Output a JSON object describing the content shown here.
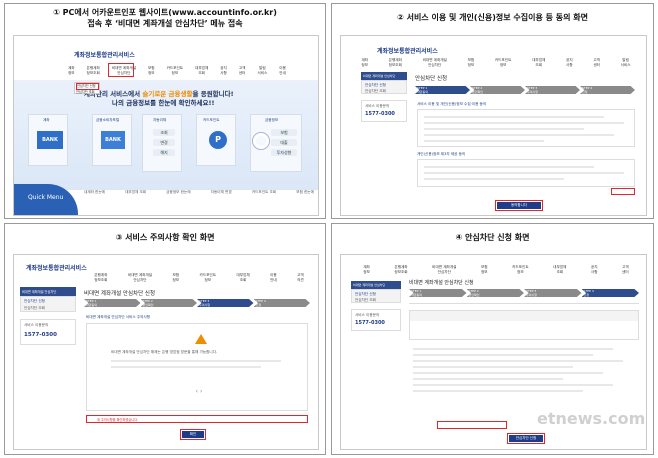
{
  "captions": {
    "p1_line1": "① PC에서 어카운트인포 웹사이트(www.accountinfo.or.kr)",
    "p1_line2": "접속 후 ‘비대면 계좌개설 안심차단’ 메뉴 접속",
    "p2": "② 서비스 이용 및 개인(신용)정보 수집이용 등 동의 화면",
    "p3": "③ 서비스 주의사항 확인 화면",
    "p4": "④ 안심차단 신청 화면"
  },
  "site": {
    "logo": "계좌정보통합관리서비스",
    "nav": [
      "계좌\n정보",
      "은행계좌\n정보조회",
      "비대면 계좌개설\n안심차단",
      "보험\n정보",
      "카드포인트\n정보",
      "대부업체\n조회",
      "공지\n사항",
      "고객\n센터",
      "알림\n서비스",
      "이용\n안내",
      "고객\n의견"
    ],
    "dropdown": [
      "안심차단 신청",
      "안심차단 조회"
    ],
    "hero_line1": "계좌관리 서비스에서 슬기로운 금융생활을 응원합니다!",
    "hero_line1_accent": "슬기로운 금융생활",
    "hero_line2": "나의 금융정보를 한눈에 확인하세요!!",
    "card_titles": [
      "계좌",
      "금융소비자포털",
      "카드포인트",
      "자동이체",
      "금융정보"
    ],
    "bank_label": "BANK",
    "auto_items": [
      "조회",
      "변경",
      "해지"
    ],
    "fin_items": [
      "보험",
      "대출",
      "투자성향"
    ],
    "quick_menu": "Quick Menu",
    "bottom_links": [
      "내계좌 한눈에",
      "대부업체 조회",
      "금융정보 한눈에",
      "자동이체 변경",
      "카드포인트 조회",
      "보험 한눈에",
      "본인 카드포인트",
      "계좌정보"
    ],
    "page_title": "안심차단 신청",
    "page_title_full": "비대면 계좌개설 안심차단 신청",
    "sidebar_title": "비대면 계좌개설 안심차단",
    "sidebar_items": [
      "안심차단 신청",
      "안심차단 조회"
    ],
    "contact_title": "서비스 이용문의",
    "contact_phone": "1577-0300",
    "steps": [
      "STEP 1\n약관동의",
      "STEP 2\n본인확인",
      "STEP 3\n주의사항",
      "STEP 4\n신청"
    ],
    "agree_heading": "서비스 이용 및 개인(신용)정보 수집·이용 동의",
    "agree_heading2": "개인(신용)정보 제3자 제공 동의",
    "agree_button": "동의합니다",
    "notice_heading": "비대면 계좌개설 안심차단 서비스 주의사항",
    "notice_text": "비대면 계좌개설 안심차단 해제는 은행 영업점 방문을 통해 가능합니다.",
    "notice_confirm": "위 주의사항을 확인하였습니다.",
    "confirm_button": "확인",
    "apply_button": "안심차단 신청"
  },
  "watermark": "etnews.com",
  "colors": {
    "accent": "#1f3c88",
    "highlight": "#e3262d",
    "orange": "#f08c00"
  }
}
